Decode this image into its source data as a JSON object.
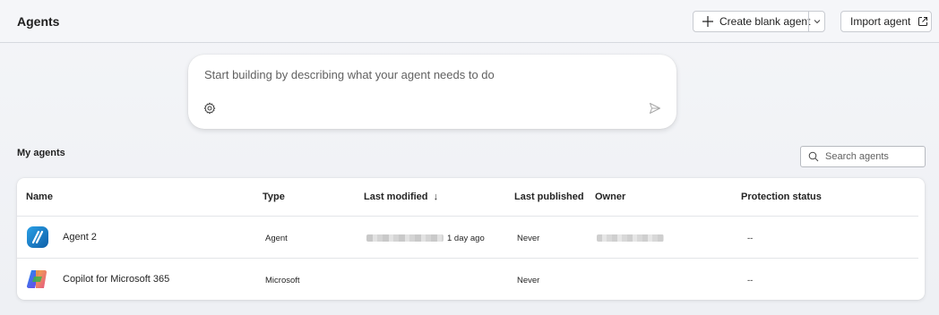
{
  "header": {
    "title": "Agents",
    "create_label": "Create blank agent",
    "import_label": "Import agent"
  },
  "prompt": {
    "placeholder": "Start building by describing what your agent needs to do"
  },
  "section": {
    "title": "My agents",
    "search_placeholder": "Search agents"
  },
  "table": {
    "columns": [
      "Name",
      "Type",
      "Last modified",
      "Last published",
      "Owner",
      "Protection status"
    ],
    "sort_indicator": "↓",
    "rows": [
      {
        "name": "Agent 2",
        "type": "Agent",
        "last_modified": "1 day ago",
        "last_published": "Never",
        "protection": "--"
      },
      {
        "name": "Copilot for Microsoft 365",
        "type": "Microsoft",
        "last_modified": "",
        "last_published": "Never",
        "protection": "--"
      }
    ]
  },
  "colors": {
    "accent": "#1f1f1f",
    "border": "#c8cbd1"
  }
}
